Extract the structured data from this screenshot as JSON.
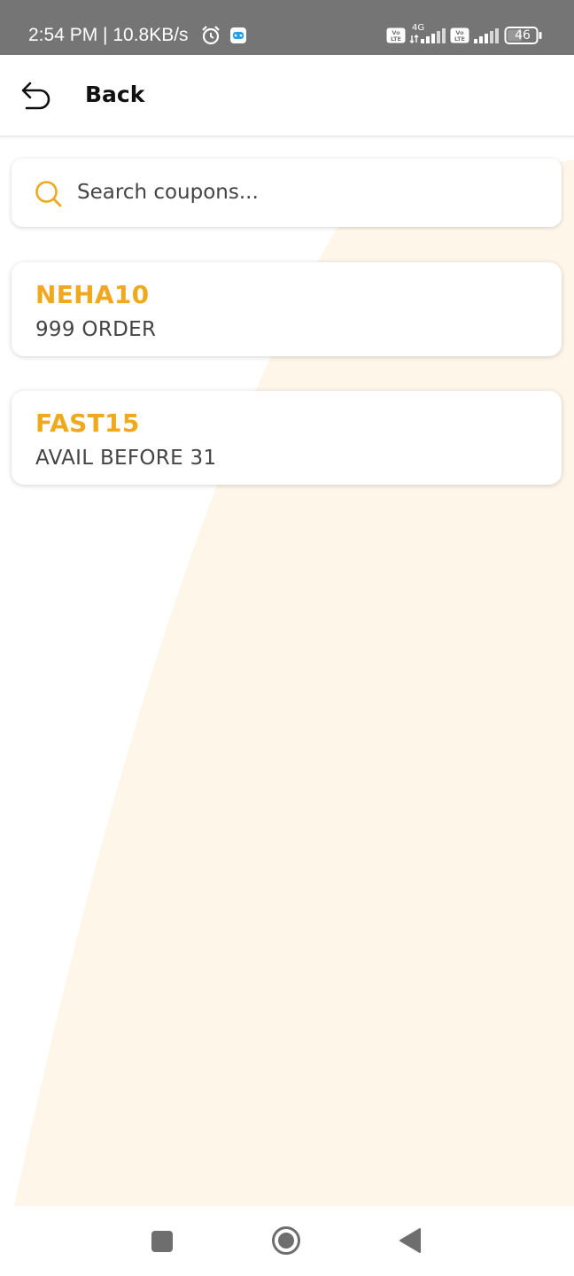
{
  "status_bar": {
    "time_speed": "2:54 PM | 10.8KB/s",
    "network_label": "4G",
    "volte_label": "Vo LTE",
    "battery_level": "46",
    "icons": [
      "alarm-icon",
      "game-icon",
      "volte-icon",
      "signal-icon",
      "battery-icon"
    ]
  },
  "app_bar": {
    "back_label": "Back",
    "icon": "back-arrow-icon"
  },
  "search": {
    "placeholder": "Search coupons...",
    "value": "",
    "icon": "search-icon"
  },
  "coupons": [
    {
      "code": "NEHA10",
      "description": "999 ORDER"
    },
    {
      "code": "FAST15",
      "description": "AVAIL BEFORE 31"
    }
  ],
  "nav_bar": {
    "buttons": [
      "recents-button",
      "home-button",
      "back-button"
    ]
  },
  "colors": {
    "accent": "#EFA91E",
    "background_tint": "#FEF6E9",
    "status_bar": "#757575",
    "text_dark": "#111111",
    "text_body": "#444444",
    "nav_icon": "#6E6E6E"
  }
}
